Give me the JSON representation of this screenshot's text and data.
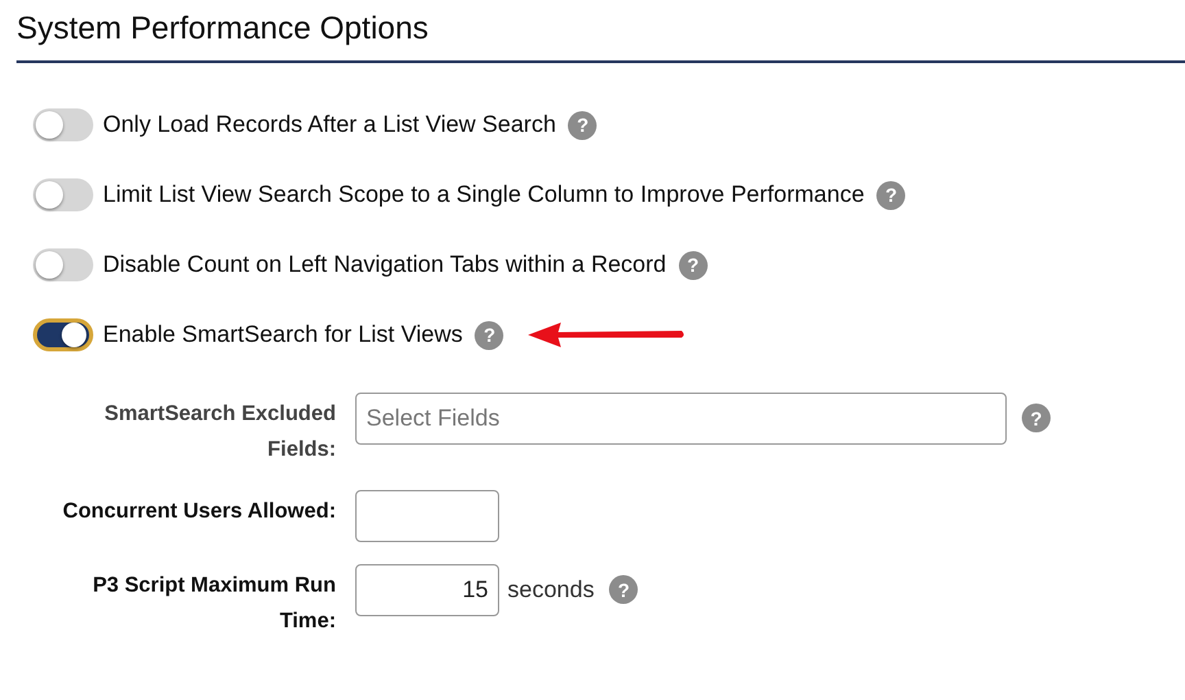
{
  "title": "System Performance Options",
  "toggles": [
    {
      "label": "Only Load Records After a List View Search",
      "on": false,
      "help": "?",
      "flagged": false
    },
    {
      "label": "Limit List View Search Scope to a Single Column to Improve Performance",
      "on": false,
      "help": "?",
      "flagged": false
    },
    {
      "label": "Disable Count on Left Navigation Tabs within a Record",
      "on": false,
      "help": "?",
      "flagged": false
    },
    {
      "label": "Enable SmartSearch for List Views",
      "on": true,
      "help": "?",
      "flagged": true
    }
  ],
  "fields": [
    {
      "label": "SmartSearch Excluded Fields:",
      "kind": "select",
      "placeholder": "Select Fields",
      "help": "?"
    },
    {
      "label": "Concurrent Users Allowed:",
      "kind": "number"
    },
    {
      "label": "P3 Script Maximum Run Time:",
      "kind": "number",
      "value": "15",
      "unit": "seconds",
      "help": "?"
    }
  ]
}
